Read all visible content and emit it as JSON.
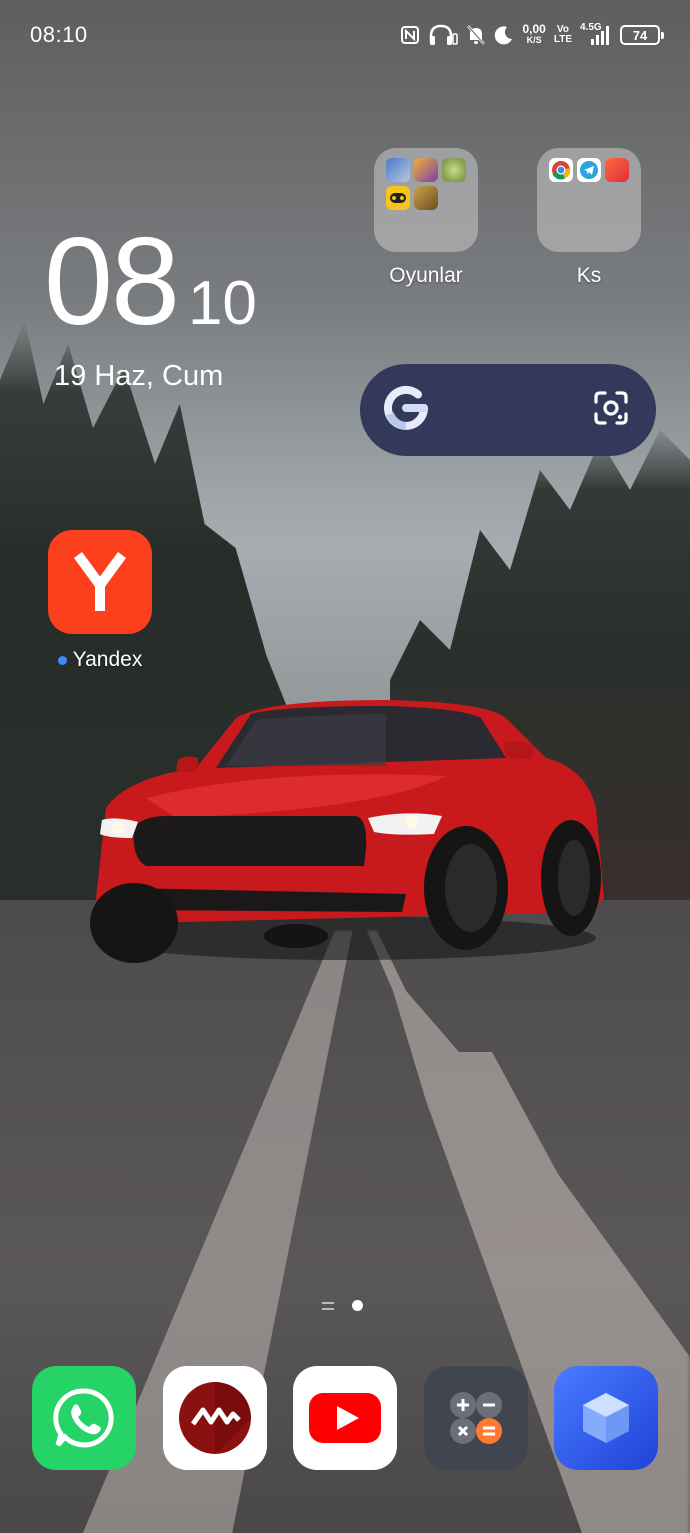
{
  "status_bar": {
    "time": "08:10",
    "net_speed_value": "0,00",
    "net_speed_unit": "K/S",
    "volte_top": "Vo",
    "volte_bottom": "LTE",
    "network_type": "4.5G",
    "battery": "74",
    "icons": [
      "nfc-icon",
      "headphones-icon",
      "bell-off-icon",
      "moon-icon",
      "signal-icon",
      "battery-icon"
    ]
  },
  "clock_widget": {
    "hours": "08",
    "minutes": "10",
    "date": "19 Haz, Cum"
  },
  "folders": [
    {
      "label": "Oyunlar",
      "apps": [
        "pubg-app",
        "clash-app",
        "snake-app",
        "game-controller-app",
        "tank-app"
      ]
    },
    {
      "label": "Ks",
      "apps": [
        "chrome-app",
        "telegram-app",
        "dragon-app"
      ]
    }
  ],
  "search_widget": {
    "icons": [
      "google-g-icon",
      "google-lens-icon"
    ]
  },
  "apps": {
    "yandex": {
      "label": "Yandex",
      "glyph": "Y",
      "color": "#fc3f1d"
    }
  },
  "dock": [
    {
      "name": "whatsapp",
      "color": "#25d366"
    },
    {
      "name": "music-player",
      "color": "#ffffff"
    },
    {
      "name": "youtube",
      "color": "#ffffff"
    },
    {
      "name": "calculator",
      "color": "#40454f"
    },
    {
      "name": "box-app",
      "color": "#2f5cf0"
    }
  ],
  "colors": {
    "search_bg": "#33395a",
    "folder_bg": "rgba(200,200,200,0.55)",
    "notification_dot": "#3b8bff"
  }
}
